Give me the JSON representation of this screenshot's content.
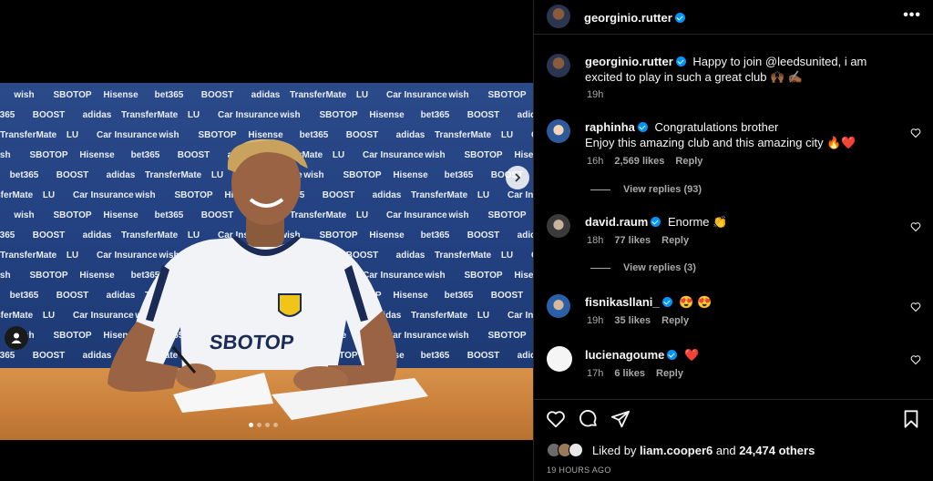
{
  "media": {
    "brands": [
      "wish",
      "SBOTOP",
      "Hisense",
      "bet365",
      "BOOST",
      "adidas",
      "TransferMate",
      "LU",
      "Car Insurance"
    ],
    "shirt_sponsor": "SBOTOP",
    "carousel": {
      "count": 4,
      "active": 1
    }
  },
  "header": {
    "username": "georginio.rutter",
    "more_label": "•••"
  },
  "caption": {
    "username": "georginio.rutter",
    "text": "Happy to join @leedsunited, i am excited to play in such a great club 🙌🏾 ✍🏾",
    "time": "19h"
  },
  "comments": [
    {
      "username": "raphinha",
      "verified": true,
      "text": "Congratulations brother\nEnjoy this amazing club and this amazing city 🔥❤️",
      "time": "16h",
      "likes": "2,569 likes",
      "reply": "Reply",
      "view_replies": "View replies (93)"
    },
    {
      "username": "david.raum",
      "verified": true,
      "text": "Enorme 👏",
      "time": "18h",
      "likes": "77 likes",
      "reply": "Reply",
      "view_replies": "View replies (3)"
    },
    {
      "username": "fisnikasllani_",
      "verified": true,
      "text": "😍 😍",
      "time": "19h",
      "likes": "35 likes",
      "reply": "Reply"
    },
    {
      "username": "lucienagoume",
      "verified": true,
      "text": "❤️",
      "time": "17h",
      "likes": "6 likes",
      "reply": "Reply"
    }
  ],
  "actions": {
    "liked_prefix": "Liked by",
    "liked_user": "liam.cooper6",
    "liked_and": "and",
    "liked_others": "24,474 others",
    "timestamp": "19 HOURS AGO"
  },
  "colors": {
    "verified": "#0095f6",
    "secondary_text": "#a8a8a8",
    "heart_red": "#ff3040",
    "backdrop_blue": "#22407f"
  }
}
